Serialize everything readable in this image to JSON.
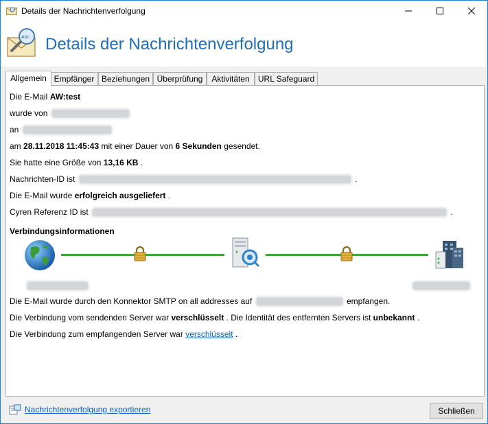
{
  "window": {
    "title": "Details der Nachrichtenverfolgung"
  },
  "header": {
    "heading": "Details der Nachrichtenverfolgung",
    "icon_name": "envelope-magnifier-icon"
  },
  "tabs": [
    {
      "label": "Allgemein",
      "active": true
    },
    {
      "label": "Empfänger",
      "active": false
    },
    {
      "label": "Beziehungen",
      "active": false
    },
    {
      "label": "Überprüfung",
      "active": false
    },
    {
      "label": "Aktivitäten",
      "active": false
    },
    {
      "label": "URL Safeguard",
      "active": false
    }
  ],
  "general": {
    "subject_prefix": "Die E-Mail",
    "subject": "AW:test",
    "from_prefix": "wurde von",
    "to_prefix": "an",
    "date_prefix": "am",
    "date": "28.11.2018 11:45:43",
    "duration_prefix": "mit einer Dauer von",
    "duration": "6 Sekunden",
    "duration_suffix": "gesendet.",
    "size_prefix": "Sie hatte eine Größe von",
    "size": "13,16 KB",
    "size_suffix": ".",
    "message_id_prefix": "Nachrichten-ID ist",
    "message_id_suffix": ".",
    "delivery_prefix": "Die E-Mail wurde",
    "delivery_status": "erfolgreich ausgeliefert",
    "delivery_suffix": ".",
    "cyren_prefix": "Cyren Referenz ID ist",
    "cyren_suffix": "."
  },
  "connection": {
    "heading": "Verbindungsinformationen",
    "received_prefix": "Die E-Mail wurde durch den Konnektor SMTP on all addresses auf",
    "received_suffix": "empfangen.",
    "sending_prefix": "Die Verbindung vom sendenden Server war",
    "sending_status": "verschlüsselt",
    "sending_middle": ". Die Identität des entfernten Servers ist",
    "identity_status": "unbekannt",
    "sending_suffix": ".",
    "receiving_prefix": "Die Verbindung zum empfangenden Server war",
    "receiving_status": "verschlüsselt",
    "receiving_suffix": ".",
    "icons": [
      "globe-icon",
      "lock-icon",
      "server-icon",
      "lock-icon",
      "buildings-icon"
    ]
  },
  "footer": {
    "export_label": "Nachrichtenverfolgung exportieren",
    "close_label": "Schließen"
  },
  "colors": {
    "accent": "#1e6db5",
    "link": "#0b5fc4",
    "connection_line": "#3fa63f",
    "window_border": "#1883d7"
  }
}
